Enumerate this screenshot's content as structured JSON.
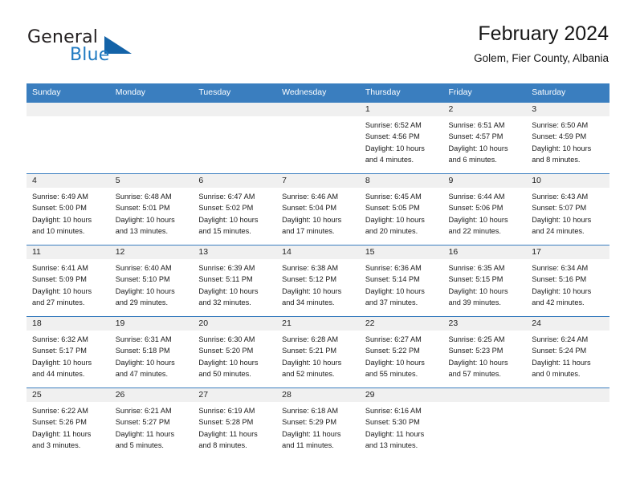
{
  "brand": {
    "name_top": "General",
    "name_bottom": "Blue",
    "accent_color": "#1463a8",
    "text_color": "#231f20"
  },
  "header": {
    "title": "February 2024",
    "subtitle": "Golem, Fier County, Albania"
  },
  "theme": {
    "header_row_bg": "#3a7ebf",
    "header_row_text": "#ffffff",
    "daynum_band_bg": "#f0f0f0",
    "row_divider": "#3a7ebf",
    "page_bg": "#ffffff"
  },
  "weekday_headers": [
    "Sunday",
    "Monday",
    "Tuesday",
    "Wednesday",
    "Thursday",
    "Friday",
    "Saturday"
  ],
  "labels": {
    "sunrise_prefix": "Sunrise:",
    "sunset_prefix": "Sunset:",
    "daylight_prefix": "Daylight:"
  },
  "weeks": [
    [
      {
        "day": "",
        "lines": []
      },
      {
        "day": "",
        "lines": []
      },
      {
        "day": "",
        "lines": []
      },
      {
        "day": "",
        "lines": []
      },
      {
        "day": "1",
        "lines": [
          "Sunrise: 6:52 AM",
          "Sunset: 4:56 PM",
          "Daylight: 10 hours",
          "and 4 minutes."
        ]
      },
      {
        "day": "2",
        "lines": [
          "Sunrise: 6:51 AM",
          "Sunset: 4:57 PM",
          "Daylight: 10 hours",
          "and 6 minutes."
        ]
      },
      {
        "day": "3",
        "lines": [
          "Sunrise: 6:50 AM",
          "Sunset: 4:59 PM",
          "Daylight: 10 hours",
          "and 8 minutes."
        ]
      }
    ],
    [
      {
        "day": "4",
        "lines": [
          "Sunrise: 6:49 AM",
          "Sunset: 5:00 PM",
          "Daylight: 10 hours",
          "and 10 minutes."
        ]
      },
      {
        "day": "5",
        "lines": [
          "Sunrise: 6:48 AM",
          "Sunset: 5:01 PM",
          "Daylight: 10 hours",
          "and 13 minutes."
        ]
      },
      {
        "day": "6",
        "lines": [
          "Sunrise: 6:47 AM",
          "Sunset: 5:02 PM",
          "Daylight: 10 hours",
          "and 15 minutes."
        ]
      },
      {
        "day": "7",
        "lines": [
          "Sunrise: 6:46 AM",
          "Sunset: 5:04 PM",
          "Daylight: 10 hours",
          "and 17 minutes."
        ]
      },
      {
        "day": "8",
        "lines": [
          "Sunrise: 6:45 AM",
          "Sunset: 5:05 PM",
          "Daylight: 10 hours",
          "and 20 minutes."
        ]
      },
      {
        "day": "9",
        "lines": [
          "Sunrise: 6:44 AM",
          "Sunset: 5:06 PM",
          "Daylight: 10 hours",
          "and 22 minutes."
        ]
      },
      {
        "day": "10",
        "lines": [
          "Sunrise: 6:43 AM",
          "Sunset: 5:07 PM",
          "Daylight: 10 hours",
          "and 24 minutes."
        ]
      }
    ],
    [
      {
        "day": "11",
        "lines": [
          "Sunrise: 6:41 AM",
          "Sunset: 5:09 PM",
          "Daylight: 10 hours",
          "and 27 minutes."
        ]
      },
      {
        "day": "12",
        "lines": [
          "Sunrise: 6:40 AM",
          "Sunset: 5:10 PM",
          "Daylight: 10 hours",
          "and 29 minutes."
        ]
      },
      {
        "day": "13",
        "lines": [
          "Sunrise: 6:39 AM",
          "Sunset: 5:11 PM",
          "Daylight: 10 hours",
          "and 32 minutes."
        ]
      },
      {
        "day": "14",
        "lines": [
          "Sunrise: 6:38 AM",
          "Sunset: 5:12 PM",
          "Daylight: 10 hours",
          "and 34 minutes."
        ]
      },
      {
        "day": "15",
        "lines": [
          "Sunrise: 6:36 AM",
          "Sunset: 5:14 PM",
          "Daylight: 10 hours",
          "and 37 minutes."
        ]
      },
      {
        "day": "16",
        "lines": [
          "Sunrise: 6:35 AM",
          "Sunset: 5:15 PM",
          "Daylight: 10 hours",
          "and 39 minutes."
        ]
      },
      {
        "day": "17",
        "lines": [
          "Sunrise: 6:34 AM",
          "Sunset: 5:16 PM",
          "Daylight: 10 hours",
          "and 42 minutes."
        ]
      }
    ],
    [
      {
        "day": "18",
        "lines": [
          "Sunrise: 6:32 AM",
          "Sunset: 5:17 PM",
          "Daylight: 10 hours",
          "and 44 minutes."
        ]
      },
      {
        "day": "19",
        "lines": [
          "Sunrise: 6:31 AM",
          "Sunset: 5:18 PM",
          "Daylight: 10 hours",
          "and 47 minutes."
        ]
      },
      {
        "day": "20",
        "lines": [
          "Sunrise: 6:30 AM",
          "Sunset: 5:20 PM",
          "Daylight: 10 hours",
          "and 50 minutes."
        ]
      },
      {
        "day": "21",
        "lines": [
          "Sunrise: 6:28 AM",
          "Sunset: 5:21 PM",
          "Daylight: 10 hours",
          "and 52 minutes."
        ]
      },
      {
        "day": "22",
        "lines": [
          "Sunrise: 6:27 AM",
          "Sunset: 5:22 PM",
          "Daylight: 10 hours",
          "and 55 minutes."
        ]
      },
      {
        "day": "23",
        "lines": [
          "Sunrise: 6:25 AM",
          "Sunset: 5:23 PM",
          "Daylight: 10 hours",
          "and 57 minutes."
        ]
      },
      {
        "day": "24",
        "lines": [
          "Sunrise: 6:24 AM",
          "Sunset: 5:24 PM",
          "Daylight: 11 hours",
          "and 0 minutes."
        ]
      }
    ],
    [
      {
        "day": "25",
        "lines": [
          "Sunrise: 6:22 AM",
          "Sunset: 5:26 PM",
          "Daylight: 11 hours",
          "and 3 minutes."
        ]
      },
      {
        "day": "26",
        "lines": [
          "Sunrise: 6:21 AM",
          "Sunset: 5:27 PM",
          "Daylight: 11 hours",
          "and 5 minutes."
        ]
      },
      {
        "day": "27",
        "lines": [
          "Sunrise: 6:19 AM",
          "Sunset: 5:28 PM",
          "Daylight: 11 hours",
          "and 8 minutes."
        ]
      },
      {
        "day": "28",
        "lines": [
          "Sunrise: 6:18 AM",
          "Sunset: 5:29 PM",
          "Daylight: 11 hours",
          "and 11 minutes."
        ]
      },
      {
        "day": "29",
        "lines": [
          "Sunrise: 6:16 AM",
          "Sunset: 5:30 PM",
          "Daylight: 11 hours",
          "and 13 minutes."
        ]
      },
      {
        "day": "",
        "lines": []
      },
      {
        "day": "",
        "lines": []
      }
    ]
  ]
}
